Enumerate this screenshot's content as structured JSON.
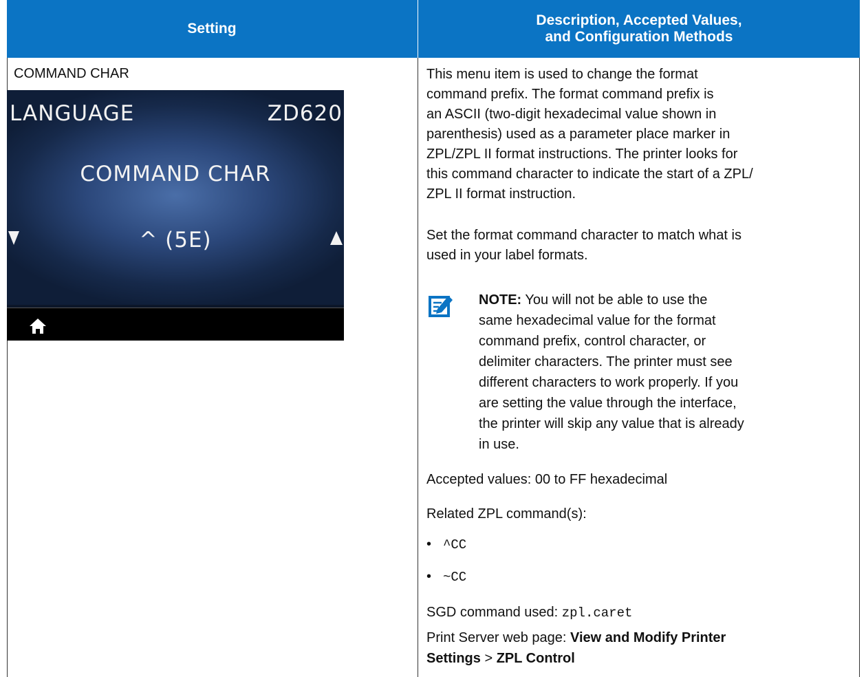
{
  "header": {
    "col1": "Setting",
    "col2_line1": "Description, Accepted Values,",
    "col2_line2": "and Configuration Methods"
  },
  "setting": {
    "name": "COMMAND CHAR",
    "screen": {
      "menu": "LANGUAGE",
      "model": "ZD620",
      "item": "COMMAND CHAR",
      "value": "^ (5E)"
    }
  },
  "description": {
    "para1_lines": [
      "This menu item is used to change the format",
      "command prefix. The format command prefix is",
      "an ASCII (two-digit hexadecimal value shown in",
      "parenthesis) used as a parameter place marker in",
      "ZPL/ZPL II format instructions. The printer looks for",
      "this command character to indicate the start of a ZPL/",
      "ZPL II format instruction."
    ],
    "para2_lines": [
      "Set the format command character to match what is",
      "used in your label formats."
    ],
    "note_label": "NOTE:",
    "note_first": " You will not be able to use the",
    "note_lines": [
      "same hexadecimal value for the format",
      "command prefix, control character, or",
      "delimiter characters. The printer must see",
      "different characters to work properly. If you",
      "are setting the value through the interface,",
      "the printer will skip any value that is already",
      "in use."
    ],
    "accepted": "Accepted values: 00 to FF hexadecimal",
    "related": "Related ZPL command(s):",
    "commands": [
      "^CC",
      "~CC"
    ],
    "sgd_label": "SGD command used: ",
    "sgd_value": "zpl.caret",
    "web_label": "Print Server web page: ",
    "web_bold1": "View and Modify Printer",
    "web_bold2": "Settings",
    "web_sep": " > ",
    "web_bold3": "ZPL Control"
  },
  "colors": {
    "header_bg": "#0b74c4",
    "note_icon": "#0b74c4"
  }
}
